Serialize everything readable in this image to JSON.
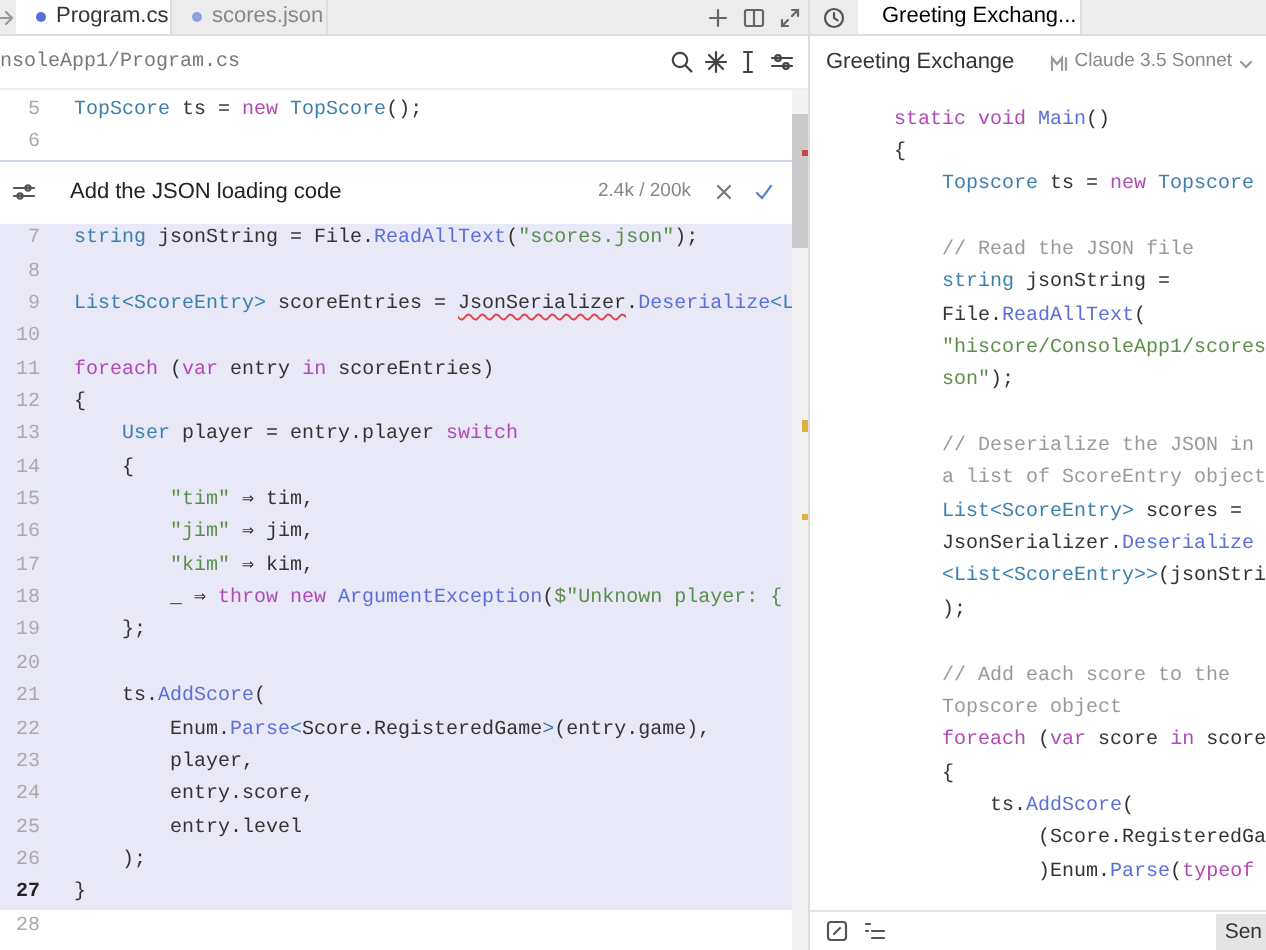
{
  "editor_tabs": [
    {
      "label": "Program.cs",
      "selected": true
    },
    {
      "label": "scores.json",
      "selected": false
    }
  ],
  "breadcrumb": "nsoleApp1/Program.cs",
  "lines_above": [
    {
      "n": "5",
      "highlighted": false,
      "current": false,
      "tokens": [
        {
          "kind": "type",
          "text": "TopScore"
        },
        {
          "kind": "plain",
          "text": " ts = "
        },
        {
          "kind": "keyword",
          "text": "new"
        },
        {
          "kind": "type",
          "text": " TopScore"
        },
        {
          "kind": "plain",
          "text": "();"
        }
      ]
    },
    {
      "n": "6",
      "highlighted": false,
      "current": false
    }
  ],
  "inline_prompt": {
    "value": "Add the JSON loading code",
    "token_count": "2.4k / 200k"
  },
  "lines_below": [
    {
      "n": "7",
      "highlighted": true,
      "current": false,
      "tokens": [
        {
          "kind": "type",
          "text": "string"
        },
        {
          "kind": "plain",
          "text": " jsonString = File."
        },
        {
          "kind": "function",
          "text": "ReadAllText"
        },
        {
          "kind": "plain",
          "text": "("
        },
        {
          "kind": "string",
          "text": "\"scores.json\""
        },
        {
          "kind": "plain",
          "text": ");"
        }
      ]
    },
    {
      "n": "8",
      "highlighted": true,
      "current": false
    },
    {
      "n": "9",
      "highlighted": true,
      "current": false,
      "tokens": [
        {
          "kind": "type",
          "text": "List<ScoreEntry>"
        },
        {
          "kind": "plain",
          "text": " scoreEntries = "
        },
        {
          "kind": "error",
          "text": "JsonSerializer"
        },
        {
          "kind": "plain",
          "text": "."
        },
        {
          "kind": "function",
          "text": "Deserialize"
        },
        {
          "kind": "type",
          "text": "<L"
        }
      ]
    },
    {
      "n": "10",
      "highlighted": true,
      "current": false
    },
    {
      "n": "11",
      "highlighted": true,
      "current": false,
      "tokens": [
        {
          "kind": "keyword",
          "text": "foreach"
        },
        {
          "kind": "plain",
          "text": " ("
        },
        {
          "kind": "keyword",
          "text": "var"
        },
        {
          "kind": "plain",
          "text": " entry "
        },
        {
          "kind": "keyword",
          "text": "in"
        },
        {
          "kind": "plain",
          "text": " scoreEntries)"
        }
      ]
    },
    {
      "n": "12",
      "highlighted": true,
      "current": false,
      "tokens": [
        {
          "kind": "plain",
          "text": "{"
        }
      ]
    },
    {
      "n": "13",
      "highlighted": true,
      "current": false,
      "tokens": [
        {
          "kind": "type",
          "text": "    User"
        },
        {
          "kind": "plain",
          "text": " player = entry.player "
        },
        {
          "kind": "keyword",
          "text": "switch"
        }
      ]
    },
    {
      "n": "14",
      "highlighted": true,
      "current": false,
      "tokens": [
        {
          "kind": "plain",
          "text": "    {"
        }
      ]
    },
    {
      "n": "15",
      "highlighted": true,
      "current": false,
      "tokens": [
        {
          "kind": "string",
          "text": "        \"tim\""
        },
        {
          "kind": "plain",
          "text": " ⇒ tim,"
        }
      ]
    },
    {
      "n": "16",
      "highlighted": true,
      "current": false,
      "tokens": [
        {
          "kind": "string",
          "text": "        \"jim\""
        },
        {
          "kind": "plain",
          "text": " ⇒ jim,"
        }
      ]
    },
    {
      "n": "17",
      "highlighted": true,
      "current": false,
      "tokens": [
        {
          "kind": "string",
          "text": "        \"kim\""
        },
        {
          "kind": "plain",
          "text": " ⇒ kim,"
        }
      ]
    },
    {
      "n": "18",
      "highlighted": true,
      "current": false,
      "tokens": [
        {
          "kind": "plain",
          "text": "        _ ⇒ "
        },
        {
          "kind": "keyword",
          "text": "throw new"
        },
        {
          "kind": "function",
          "text": " ArgumentException"
        },
        {
          "kind": "plain",
          "text": "("
        },
        {
          "kind": "string",
          "text": "$\"Unknown player: {"
        }
      ]
    },
    {
      "n": "19",
      "highlighted": true,
      "current": false,
      "tokens": [
        {
          "kind": "plain",
          "text": "    };"
        }
      ]
    },
    {
      "n": "20",
      "highlighted": true,
      "current": false
    },
    {
      "n": "21",
      "highlighted": true,
      "current": false,
      "tokens": [
        {
          "kind": "plain",
          "text": "    ts."
        },
        {
          "kind": "function",
          "text": "AddScore"
        },
        {
          "kind": "plain",
          "text": "("
        }
      ]
    },
    {
      "n": "22",
      "highlighted": true,
      "current": false,
      "tokens": [
        {
          "kind": "plain",
          "text": "        Enum."
        },
        {
          "kind": "function",
          "text": "Parse"
        },
        {
          "kind": "type",
          "text": "<"
        },
        {
          "kind": "plain",
          "text": "Score.RegisteredGame"
        },
        {
          "kind": "type",
          "text": ">"
        },
        {
          "kind": "plain",
          "text": "(entry.game),"
        }
      ]
    },
    {
      "n": "23",
      "highlighted": true,
      "current": false,
      "tokens": [
        {
          "kind": "plain",
          "text": "        player,"
        }
      ]
    },
    {
      "n": "24",
      "highlighted": true,
      "current": false,
      "tokens": [
        {
          "kind": "plain",
          "text": "        entry.score,"
        }
      ]
    },
    {
      "n": "25",
      "highlighted": true,
      "current": false,
      "tokens": [
        {
          "kind": "plain",
          "text": "        entry.level"
        }
      ]
    },
    {
      "n": "26",
      "highlighted": true,
      "current": false,
      "tokens": [
        {
          "kind": "plain",
          "text": "    );"
        }
      ]
    },
    {
      "n": "27",
      "highlighted": true,
      "current": true,
      "tokens": [
        {
          "kind": "plain",
          "text": "}"
        }
      ]
    },
    {
      "n": "28",
      "highlighted": false,
      "current": false
    }
  ],
  "chat": {
    "tabs": [
      {
        "label": "Greeting Exchang...",
        "selected": true
      }
    ],
    "title": "Greeting Exchange",
    "model": "Claude 3.5 Sonnet",
    "code": [
      {
        "tokens": [
          {
            "kind": "keyword",
            "text": "    static void"
          },
          {
            "kind": "function",
            "text": " Main"
          },
          {
            "kind": "plain",
            "text": "()"
          }
        ]
      },
      {
        "tokens": [
          {
            "kind": "plain",
            "text": "    {"
          }
        ]
      },
      {
        "tokens": [
          {
            "kind": "type",
            "text": "        Topscore"
          },
          {
            "kind": "plain",
            "text": " ts = "
          },
          {
            "kind": "keyword",
            "text": "new"
          },
          {
            "kind": "type",
            "text": " Topscore"
          }
        ]
      },
      {
        "kind": "blank"
      },
      {
        "tokens": [
          {
            "kind": "comment",
            "text": "        // Read the JSON file"
          }
        ]
      },
      {
        "tokens": [
          {
            "kind": "type",
            "text": "        string"
          },
          {
            "kind": "plain",
            "text": " jsonString ="
          }
        ]
      },
      {
        "tokens": [
          {
            "kind": "plain",
            "text": "        File."
          },
          {
            "kind": "function",
            "text": "ReadAllText"
          },
          {
            "kind": "plain",
            "text": "("
          }
        ]
      },
      {
        "tokens": [
          {
            "kind": "string",
            "text": "        \"hiscore/ConsoleApp1/scores"
          }
        ]
      },
      {
        "tokens": [
          {
            "kind": "string",
            "text": "        son\""
          },
          {
            "kind": "plain",
            "text": ");"
          }
        ]
      },
      {
        "kind": "blank"
      },
      {
        "tokens": [
          {
            "kind": "comment",
            "text": "        // Deserialize the JSON in"
          }
        ]
      },
      {
        "tokens": [
          {
            "kind": "comment",
            "text": "        a list of ScoreEntry object"
          }
        ]
      },
      {
        "tokens": [
          {
            "kind": "type",
            "text": "        List<ScoreEntry>"
          },
          {
            "kind": "plain",
            "text": " scores ="
          }
        ]
      },
      {
        "tokens": [
          {
            "kind": "plain",
            "text": "        JsonSerializer."
          },
          {
            "kind": "function",
            "text": "Deserialize"
          }
        ]
      },
      {
        "tokens": [
          {
            "kind": "type",
            "text": "        <List<ScoreEntry>>"
          },
          {
            "kind": "plain",
            "text": "(jsonStri"
          }
        ]
      },
      {
        "tokens": [
          {
            "kind": "plain",
            "text": "        );"
          }
        ]
      },
      {
        "kind": "blank"
      },
      {
        "tokens": [
          {
            "kind": "comment",
            "text": "        // Add each score to the"
          }
        ]
      },
      {
        "tokens": [
          {
            "kind": "comment",
            "text": "        Topscore object"
          }
        ]
      },
      {
        "tokens": [
          {
            "kind": "keyword",
            "text": "        foreach"
          },
          {
            "kind": "plain",
            "text": " ("
          },
          {
            "kind": "keyword",
            "text": "var"
          },
          {
            "kind": "plain",
            "text": " score "
          },
          {
            "kind": "keyword",
            "text": "in"
          },
          {
            "kind": "plain",
            "text": " score"
          }
        ]
      },
      {
        "tokens": [
          {
            "kind": "plain",
            "text": "        {"
          }
        ]
      },
      {
        "tokens": [
          {
            "kind": "plain",
            "text": "            ts."
          },
          {
            "kind": "function",
            "text": "AddScore"
          },
          {
            "kind": "plain",
            "text": "("
          }
        ]
      },
      {
        "tokens": [
          {
            "kind": "plain",
            "text": "                (Score.RegisteredGa"
          }
        ]
      },
      {
        "tokens": [
          {
            "kind": "plain",
            "text": "                )Enum."
          },
          {
            "kind": "function",
            "text": "Parse"
          },
          {
            "kind": "plain",
            "text": "("
          },
          {
            "kind": "keyword",
            "text": "typeof"
          }
        ]
      }
    ],
    "send_button": "Sen"
  }
}
